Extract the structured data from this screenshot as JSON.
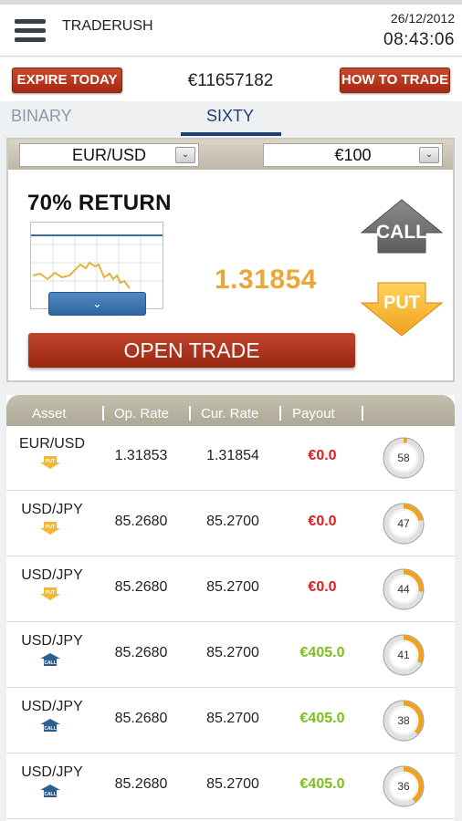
{
  "header": {
    "logo": {
      "part1": "TRADE",
      "part2": "RUSH"
    },
    "date": "26/12/2012",
    "time": "08:43:06"
  },
  "actionbar": {
    "expire_label": "EXPIRE TODAY",
    "balance": "€11657182",
    "howto_label": "HOW TO TRADE"
  },
  "tabs": [
    {
      "label": "BINARY",
      "active": false
    },
    {
      "label": "SIXTY",
      "active": true
    }
  ],
  "trade": {
    "asset_select": "EUR/USD",
    "amount_select": "€100",
    "return_label": "70% RETURN",
    "current_rate": "1.31854",
    "call_label": "CALL",
    "put_label": "PUT",
    "open_trade_label": "OPEN TRADE"
  },
  "table": {
    "columns": [
      "Asset",
      "Op. Rate",
      "Cur. Rate",
      "Payout"
    ],
    "rows": [
      {
        "asset": "EUR/USD",
        "direction": "PUT",
        "op_rate": "1.31853",
        "cur_rate": "1.31854",
        "payout": "€0.0",
        "payout_color": "#e01b1b",
        "timer": "58",
        "progress": 0.03
      },
      {
        "asset": "USD/JPY",
        "direction": "PUT",
        "op_rate": "85.2680",
        "cur_rate": "85.2700",
        "payout": "€0.0",
        "payout_color": "#e01b1b",
        "timer": "47",
        "progress": 0.22
      },
      {
        "asset": "USD/JPY",
        "direction": "PUT",
        "op_rate": "85.2680",
        "cur_rate": "85.2700",
        "payout": "€0.0",
        "payout_color": "#e01b1b",
        "timer": "44",
        "progress": 0.27
      },
      {
        "asset": "USD/JPY",
        "direction": "CALL",
        "op_rate": "85.2680",
        "cur_rate": "85.2700",
        "payout": "€405.0",
        "payout_color": "#7ac21a",
        "timer": "41",
        "progress": 0.32
      },
      {
        "asset": "USD/JPY",
        "direction": "CALL",
        "op_rate": "85.2680",
        "cur_rate": "85.2700",
        "payout": "€405.0",
        "payout_color": "#7ac21a",
        "timer": "38",
        "progress": 0.37
      },
      {
        "asset": "USD/JPY",
        "direction": "CALL",
        "op_rate": "85.2680",
        "cur_rate": "85.2700",
        "payout": "€405.0",
        "payout_color": "#7ac21a",
        "timer": "36",
        "progress": 0.4
      }
    ]
  },
  "colors": {
    "brand_orange": "#f0a21c",
    "brand_navy": "#1f3e78",
    "button_red": "#b5361f",
    "rate_orange": "#e9a73a",
    "put_orange": "#f5b731",
    "call_gray": "#6f6f6f"
  },
  "icons": {
    "menu": "hamburger-menu-icon",
    "chart_toggle": "chevron-down-icon",
    "select_arrow": "chevron-down-icon",
    "call": "up-arrow-house-icon",
    "put": "down-arrow-icon",
    "timer": "countdown-ring-icon"
  }
}
